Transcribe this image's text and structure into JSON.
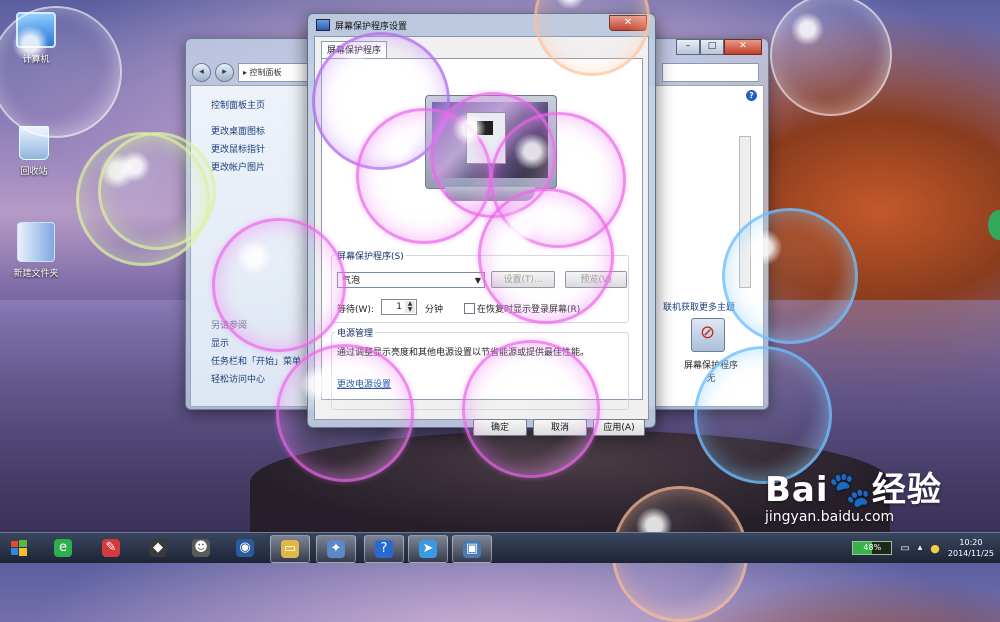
{
  "desktop": {
    "icons": [
      {
        "label": "计算机",
        "icon": "computer-icon"
      },
      {
        "label": "回收站",
        "icon": "recycle-bin-icon"
      },
      {
        "label": "新建文件夹",
        "icon": "folder-icon"
      }
    ]
  },
  "control_panel": {
    "address": "▸ 控制面板",
    "sidebar": {
      "links": [
        "控制面板主页",
        "更改桌面图标",
        "更改鼠标指针",
        "更改帐户图片"
      ],
      "see_also_header": "另请参阅",
      "see_also": [
        "显示",
        "任务栏和「开始」菜单",
        "轻松访问中心"
      ]
    },
    "get_more_themes": "联机获取更多主题",
    "screensaver_label": "屏幕保护程序",
    "screensaver_sub": "无"
  },
  "dialog": {
    "title": "屏幕保护程序设置",
    "tab": "屏幕保护程序",
    "screensaver_group_label": "屏幕保护程序(S)",
    "screensaver_value": "气泡",
    "settings_button": "设置(T)...",
    "preview_button": "预览(V)",
    "wait_label": "等待(W):",
    "wait_value": "1",
    "wait_unit": "分钟",
    "resume_checkbox_label": "在恢复时显示登录屏幕(R)",
    "power_group_label": "电源管理",
    "power_description": "通过调整显示亮度和其他电源设置以节省能源或提供最佳性能。",
    "power_link": "更改电源设置",
    "ok_button": "确定",
    "cancel_button": "取消",
    "apply_button": "应用(A)"
  },
  "taskbar": {
    "items": [
      {
        "icon": "browser-icon",
        "color": "#2fae4e",
        "glyph": "e"
      },
      {
        "icon": "paint-icon",
        "color": "#d43a3a",
        "glyph": "✎"
      },
      {
        "icon": "fox-icon",
        "color": "#3a3a3a",
        "glyph": "◆"
      },
      {
        "icon": "alien-icon",
        "color": "#5a5a5a",
        "glyph": "☻"
      },
      {
        "icon": "webcam-icon",
        "color": "#2c5aa0",
        "glyph": "◉"
      },
      {
        "icon": "folder-icon",
        "color": "#e0b84a",
        "glyph": "▭"
      },
      {
        "icon": "personalize-icon",
        "color": "#5a88c8",
        "glyph": "✦"
      },
      {
        "icon": "help-icon",
        "color": "#2a6ad0",
        "glyph": "?"
      },
      {
        "icon": "bird-icon",
        "color": "#3a9ae0",
        "glyph": "➤"
      },
      {
        "icon": "display-icon",
        "color": "#4a7ab0",
        "glyph": "▣"
      }
    ],
    "battery": "48%",
    "time": "10:20",
    "date": "2014/11/25"
  },
  "watermark": {
    "brand": "Bai",
    "brand2": "经验",
    "url": "jingyan.baidu.com"
  }
}
